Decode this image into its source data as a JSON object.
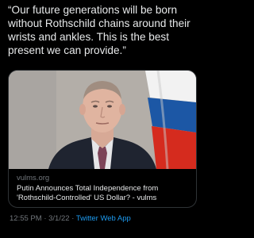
{
  "tweet": {
    "text": "“Our future generations will be born without Rothschild chains around their wrists and ankles. This is the best present we can provide.”"
  },
  "card": {
    "image": {
      "subject": "man-in-suit-photo",
      "flag_colors": [
        "#ffffff",
        "#1c57a5",
        "#d52b1e"
      ]
    },
    "domain": "vulms.org",
    "title_line1": "Putin Announces Total Independence from",
    "title_line2": "'Rothschild-Controlled' US Dollar? - vulms"
  },
  "meta": {
    "time": "12:55 PM",
    "separator1": "·",
    "date": "3/1/22",
    "separator2": "·",
    "app": "Twitter Web App"
  },
  "colors": {
    "background": "#000000",
    "text": "#e7e9ea",
    "secondary": "#71767b",
    "link": "#1d9bf0"
  }
}
